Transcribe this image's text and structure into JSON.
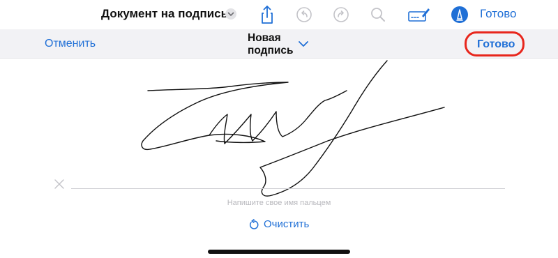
{
  "top_bar": {
    "document_title": "Документ на подпись",
    "done_label": "Готово"
  },
  "signature_bar": {
    "cancel_label": "Отменить",
    "signature_selector": "Новая подпись",
    "done_label": "Готово"
  },
  "canvas": {
    "hint": "Напишите свое имя пальцем",
    "clear_label": "Очистить"
  },
  "colors": {
    "accent": "#1f6fd6",
    "highlight_ring": "#e8261c",
    "bar_background": "#f2f2f5"
  },
  "icons": [
    "chevron-down-icon",
    "share-icon",
    "undo-icon",
    "redo-icon",
    "search-icon",
    "signature-icon",
    "markup-pen-icon",
    "close-icon",
    "reset-icon"
  ]
}
